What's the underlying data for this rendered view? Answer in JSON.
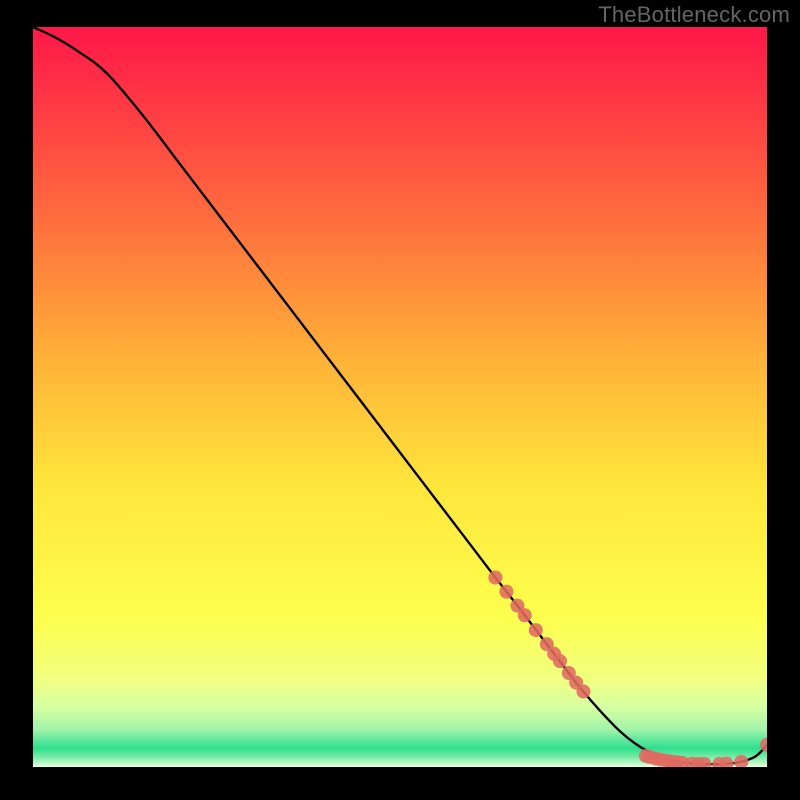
{
  "watermark": "TheBottleneck.com",
  "colors": {
    "curve": "#000000",
    "marker_fill": "#e06a61",
    "marker_stroke": "#b44d45",
    "gradient_top": "#ff1748",
    "gradient_mid1": "#ff7b3b",
    "gradient_mid2": "#ffd236",
    "gradient_mid3": "#fffd4a",
    "gradient_low": "#d7ffa0",
    "gradient_green": "#2fe08c"
  },
  "chart_data": {
    "type": "line",
    "title": "",
    "xlabel": "",
    "ylabel": "",
    "xlim": [
      0,
      100
    ],
    "ylim": [
      0,
      100
    ],
    "series": [
      {
        "name": "bottleneck-curve",
        "x": [
          0,
          3,
          6,
          10,
          15,
          20,
          25,
          30,
          35,
          40,
          45,
          50,
          55,
          60,
          63,
          66,
          69,
          72,
          74,
          76,
          78,
          80,
          82,
          84,
          86,
          87,
          88,
          89,
          90,
          91,
          92,
          94,
          96,
          98,
          99,
          100
        ],
        "y": [
          100,
          98.6,
          96.8,
          93.8,
          88.0,
          81.5,
          75.0,
          68.5,
          62.0,
          55.5,
          49.0,
          42.5,
          36.0,
          29.5,
          25.6,
          21.8,
          17.9,
          14.0,
          11.4,
          9.0,
          6.8,
          4.8,
          3.2,
          2.0,
          1.2,
          0.9,
          0.7,
          0.55,
          0.45,
          0.4,
          0.38,
          0.4,
          0.6,
          1.2,
          1.9,
          3.0
        ]
      }
    ],
    "markers": [
      {
        "x": 63.0,
        "y": 25.6
      },
      {
        "x": 64.5,
        "y": 23.7
      },
      {
        "x": 66.0,
        "y": 21.8
      },
      {
        "x": 67.0,
        "y": 20.5
      },
      {
        "x": 68.5,
        "y": 18.5
      },
      {
        "x": 70.0,
        "y": 16.6
      },
      {
        "x": 71.0,
        "y": 15.3
      },
      {
        "x": 71.8,
        "y": 14.3
      },
      {
        "x": 73.0,
        "y": 12.7
      },
      {
        "x": 74.0,
        "y": 11.4
      },
      {
        "x": 75.0,
        "y": 10.2
      },
      {
        "x": 83.5,
        "y": 1.5
      },
      {
        "x": 84.0,
        "y": 1.35
      },
      {
        "x": 84.8,
        "y": 1.15
      },
      {
        "x": 85.5,
        "y": 1.0
      },
      {
        "x": 86.3,
        "y": 0.85
      },
      {
        "x": 87.0,
        "y": 0.75
      },
      {
        "x": 87.8,
        "y": 0.65
      },
      {
        "x": 88.5,
        "y": 0.55
      },
      {
        "x": 89.8,
        "y": 0.45
      },
      {
        "x": 90.7,
        "y": 0.42
      },
      {
        "x": 91.5,
        "y": 0.4
      },
      {
        "x": 93.5,
        "y": 0.4
      },
      {
        "x": 94.5,
        "y": 0.45
      },
      {
        "x": 96.5,
        "y": 0.7
      },
      {
        "x": 100.0,
        "y": 3.0
      }
    ]
  }
}
